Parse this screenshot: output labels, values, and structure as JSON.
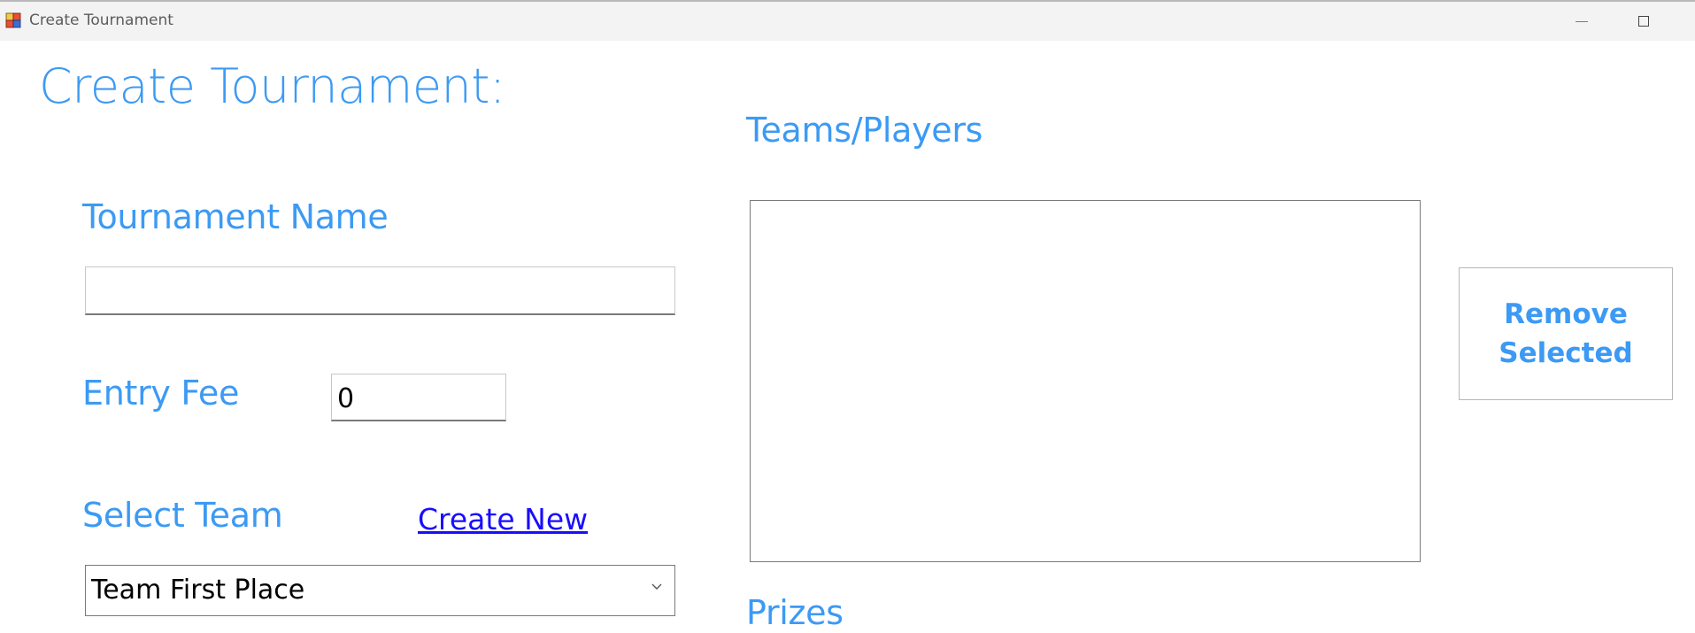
{
  "window": {
    "title": "Create Tournament"
  },
  "form": {
    "heading": "Create Tournament:",
    "tournament_name_label": "Tournament Name",
    "tournament_name_value": "",
    "entry_fee_label": "Entry Fee",
    "entry_fee_value": "0",
    "select_team_label": "Select Team",
    "create_new_link": "Create New",
    "selected_team": "Team First Place",
    "teams_players_label": "Teams/Players",
    "teams_players_items": [],
    "remove_selected_line1": "Remove",
    "remove_selected_line2": "Selected",
    "prizes_label": "Prizes"
  },
  "colors": {
    "accent": "#3c9af4",
    "link": "#1a0dff"
  },
  "icons": {
    "app": "app-icon",
    "minimize": "minimize-icon",
    "maximize": "maximize-icon",
    "dropdown": "chevron-down-icon"
  }
}
